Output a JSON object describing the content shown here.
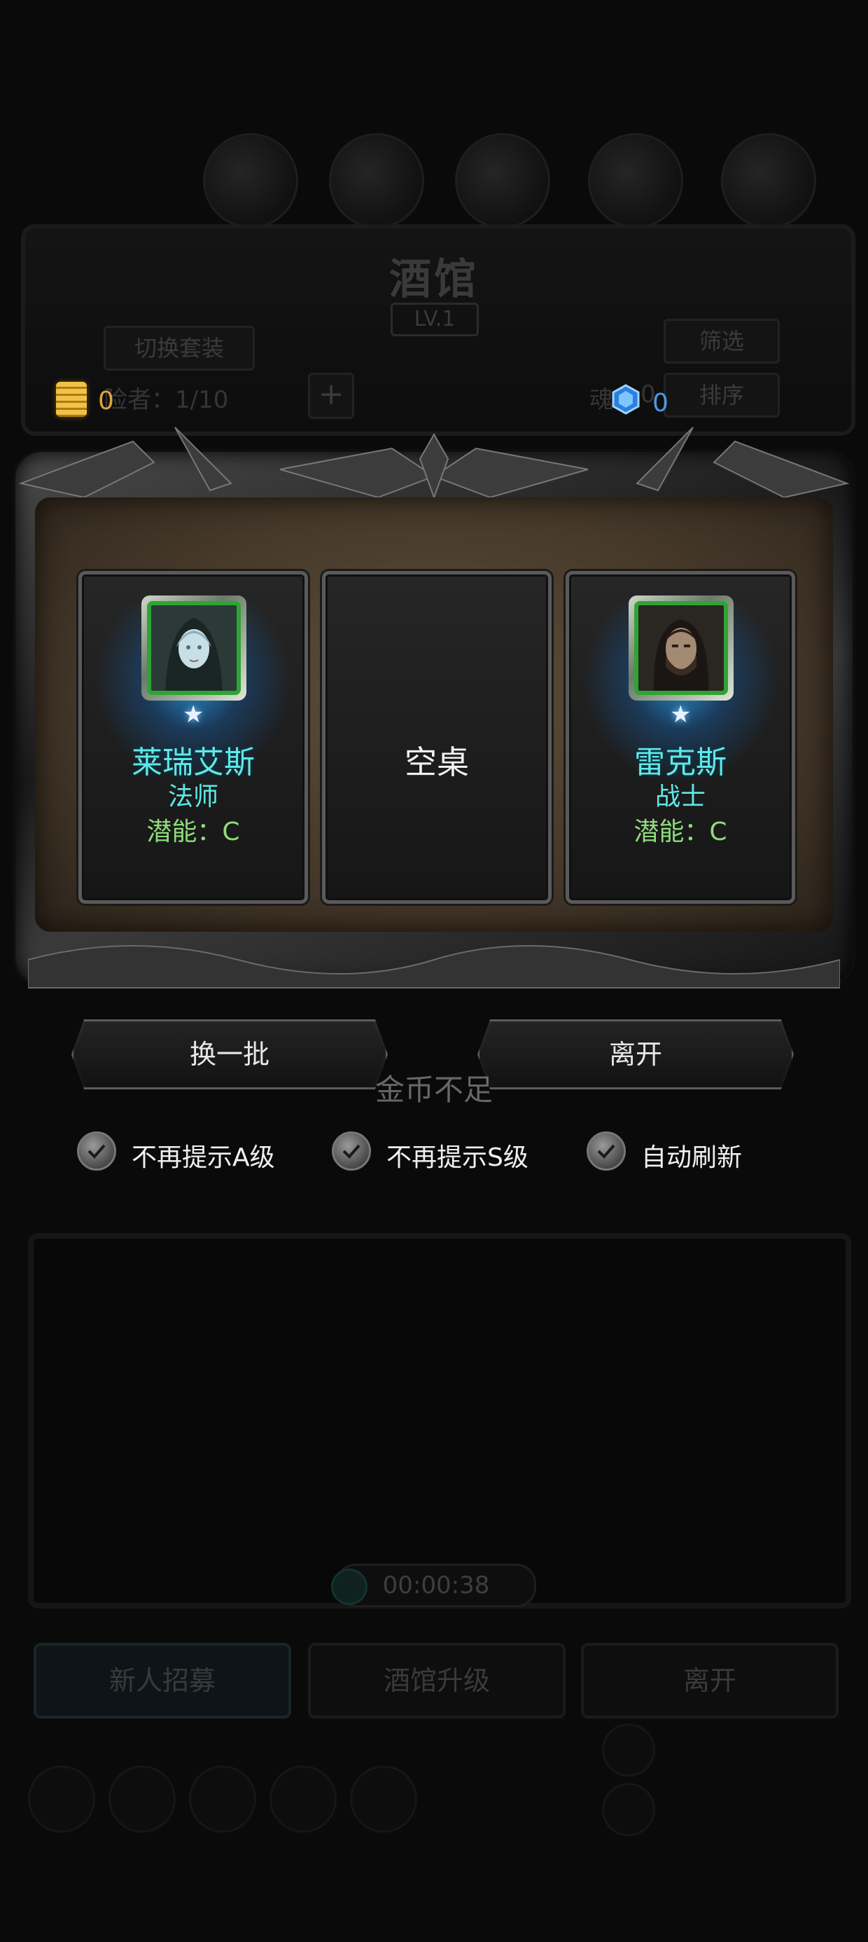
{
  "background": {
    "title": "酒馆",
    "level": "LV.1",
    "switch_outfit_label": "切换套装",
    "filter_label": "筛选",
    "sort_label": "排序",
    "adventurer_count": "险者：1/10",
    "soul_label": "魂",
    "soul_value": "0",
    "timer": "00:00:38",
    "tabs": [
      "新人招募",
      "酒馆升级",
      "离开"
    ]
  },
  "resources": {
    "gold": "0",
    "gems": "0"
  },
  "dialog": {
    "cards": [
      {
        "name": "莱瑞艾斯",
        "class": "法师",
        "potential": "潜能：C",
        "empty": false
      },
      {
        "empty_label": "空桌",
        "empty": true
      },
      {
        "name": "雷克斯",
        "class": "战士",
        "potential": "潜能：C",
        "empty": false
      }
    ],
    "refresh_label": "换一批",
    "leave_label": "离开",
    "toast": "金币不足",
    "options": [
      {
        "label": "不再提示A级",
        "checked": true
      },
      {
        "label": "不再提示S级",
        "checked": true
      },
      {
        "label": "自动刷新",
        "checked": true
      }
    ]
  },
  "colors": {
    "hero_name": "#5ee9e9",
    "potential": "#8edc7a",
    "gold_text": "#e0a53a",
    "gem_text": "#4a9ae8",
    "portrait_frame": "#2fa434"
  }
}
